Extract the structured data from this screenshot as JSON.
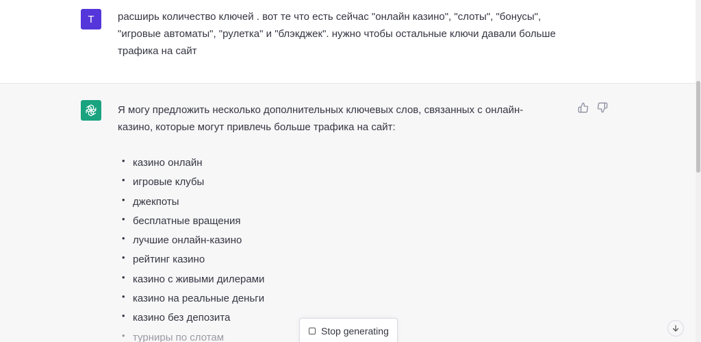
{
  "user_message": {
    "avatar_letter": "T",
    "avatar_color": "#5436da",
    "text": "расширь количество ключей . вот те что есть сейчас \"онлайн казино\", \"слоты\", \"бонусы\", \"игровые автоматы\", \"рулетка\" и \"блэкджек\". нужно чтобы остальные ключи давали больше трафика на сайт"
  },
  "assistant_message": {
    "avatar_icon": "openai-logo-icon",
    "avatar_color": "#19a37f",
    "intro": "Я могу предложить несколько дополнительных ключевых слов, связанных с онлайн-казино, которые могут привлечь больше трафика на сайт:",
    "items": [
      "казино онлайн",
      "игровые клубы",
      "джекпоты",
      "бесплатные вращения",
      "лучшие онлайн-казино",
      "рейтинг казино",
      "казино с живыми дилерами",
      "казино на реальные деньги",
      "казино без депозита",
      "турниры по слотам"
    ]
  },
  "feedback": {
    "thumbs_up_icon": "thumbs-up-icon",
    "thumbs_down_icon": "thumbs-down-icon"
  },
  "controls": {
    "stop_label": "Stop generating",
    "scroll_down_icon": "arrow-down-icon"
  }
}
